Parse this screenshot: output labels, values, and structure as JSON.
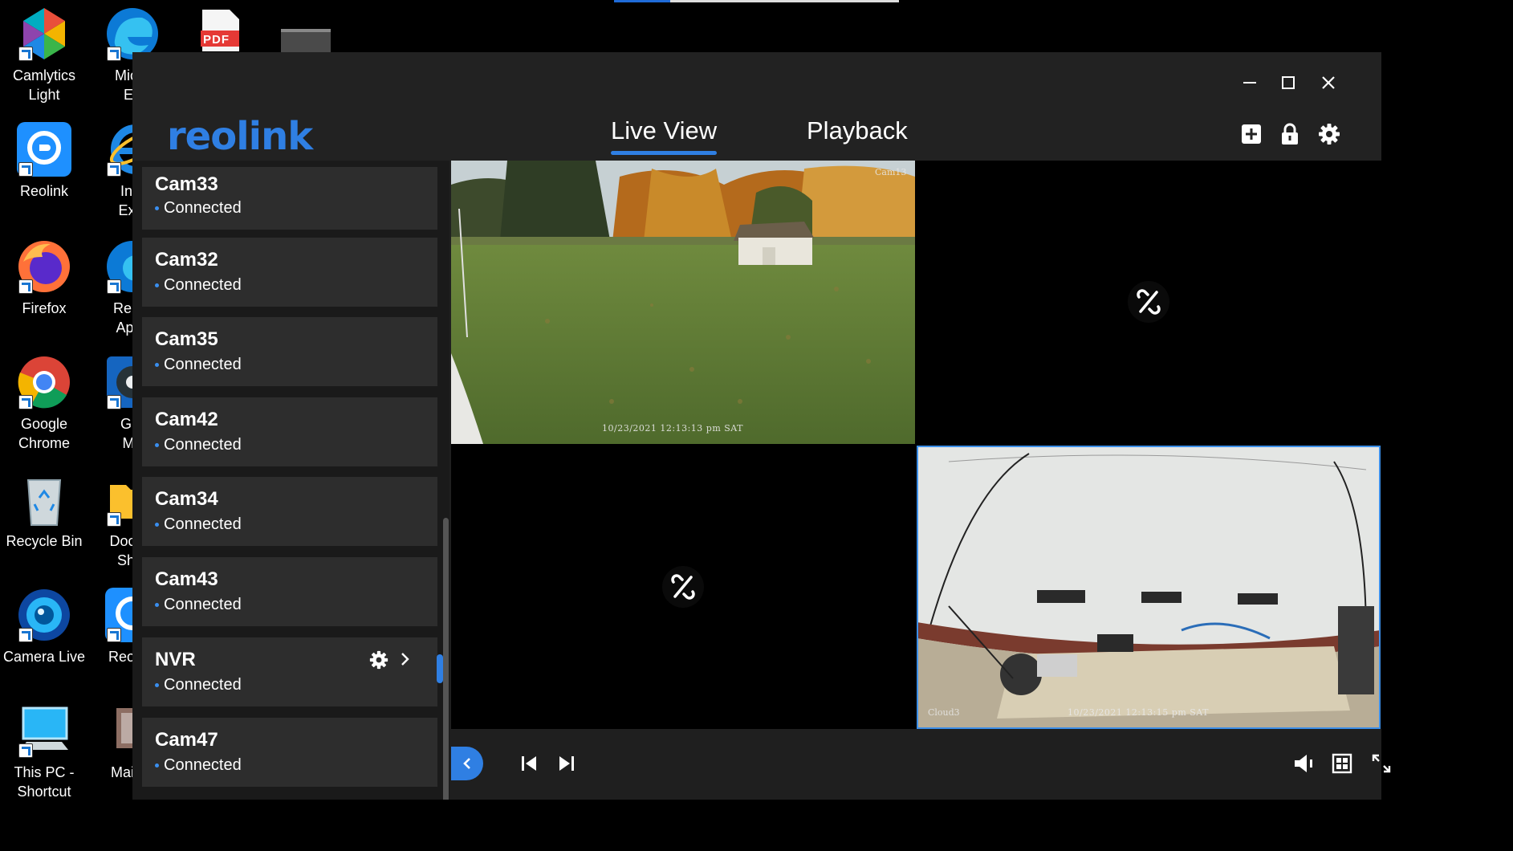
{
  "desktop": {
    "icons_col1": [
      {
        "label_l1": "Camlytics",
        "label_l2": "Light",
        "icon": "camlytics-icon"
      },
      {
        "label_l1": "Reolink",
        "label_l2": "",
        "icon": "reolink-desktop-icon"
      },
      {
        "label_l1": "Firefox",
        "label_l2": "",
        "icon": "firefox-icon"
      },
      {
        "label_l1": "Google",
        "label_l2": "Chrome",
        "icon": "chrome-icon"
      },
      {
        "label_l1": "Recycle Bin",
        "label_l2": "",
        "icon": "recycle-bin-icon"
      },
      {
        "label_l1": "Camera Live",
        "label_l2": "",
        "icon": "camera-live-icon"
      },
      {
        "label_l1": "This PC -",
        "label_l2": "Shortcut",
        "icon": "this-pc-icon"
      }
    ],
    "icons_col2": [
      {
        "label_l1": "Micro",
        "label_l2": "Ed"
      },
      {
        "label_l1": "Inte",
        "label_l2": "Expl"
      },
      {
        "label_l1": "Remo",
        "label_l2": "Apps"
      },
      {
        "label_l1": "Gro",
        "label_l2": "Mu"
      },
      {
        "label_l1": "Docum",
        "label_l2": "Shor"
      },
      {
        "label_l1": "Reolink",
        "label_l2": ""
      },
      {
        "label_l1": "Mail-M",
        "label_l2": ""
      }
    ],
    "pdf_label": "PDF"
  },
  "app": {
    "logo": "reolink",
    "tabs": [
      {
        "label": "Live View",
        "active": true
      },
      {
        "label": "Playback",
        "active": false
      }
    ],
    "accent": "#2f7fe3"
  },
  "devices": [
    {
      "name": "Cam33",
      "status": "Connected"
    },
    {
      "name": "Cam32",
      "status": "Connected"
    },
    {
      "name": "Cam35",
      "status": "Connected"
    },
    {
      "name": "Cam42",
      "status": "Connected"
    },
    {
      "name": "Cam34",
      "status": "Connected"
    },
    {
      "name": "Cam43",
      "status": "Connected"
    },
    {
      "name": "NVR",
      "status": "Connected"
    },
    {
      "name": "Cam47",
      "status": "Connected"
    }
  ],
  "panes": {
    "top_left": {
      "label": "Cam13",
      "timestamp": "10/23/2021 12:13:13 pm SAT"
    },
    "bottom_right": {
      "label": "Cloud3",
      "timestamp": "10/23/2021 12:13:15 pm SAT"
    }
  }
}
